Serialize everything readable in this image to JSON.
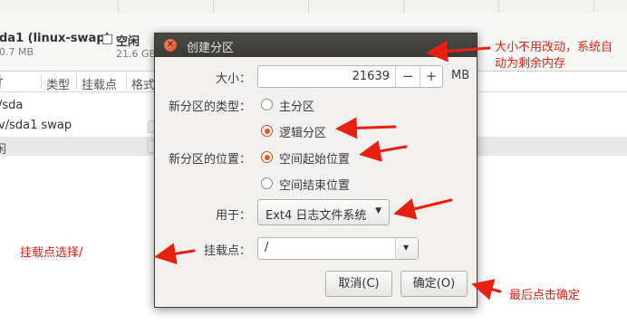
{
  "background": {
    "partition": {
      "name": "da1 (linux-swap)",
      "size": "0.7 MB"
    },
    "free": {
      "name": "空闲",
      "size": "21.6 GB"
    },
    "columns": [
      "类型",
      "挂载点",
      "格式"
    ],
    "rows": [
      "/sda",
      "v/sda1  swap"
    ],
    "selected_row": "闲"
  },
  "dialog": {
    "title": "创建分区",
    "size_label": "大小：",
    "size_value": "21639",
    "minus": "−",
    "plus": "+",
    "unit": "MB",
    "type_label": "新分区的类型：",
    "type_primary": "主分区",
    "type_logical": "逻辑分区",
    "position_label": "新分区的位置：",
    "position_start": "空间起始位置",
    "position_end": "空间结束位置",
    "use_label": "用于：",
    "use_value": "Ext4 日志文件系统",
    "mount_label": "挂载点：",
    "mount_value": "/",
    "cancel": "取消(C)",
    "ok": "确定(O)",
    "type_selected": "逻辑分区",
    "position_selected": "空间起始位置"
  },
  "annotations": {
    "size_note": "大小不用改动，系统自动为剩余内存",
    "mount_note": "挂载点选择/",
    "ok_note": "最后点击确定",
    "color": "#e8200f"
  }
}
